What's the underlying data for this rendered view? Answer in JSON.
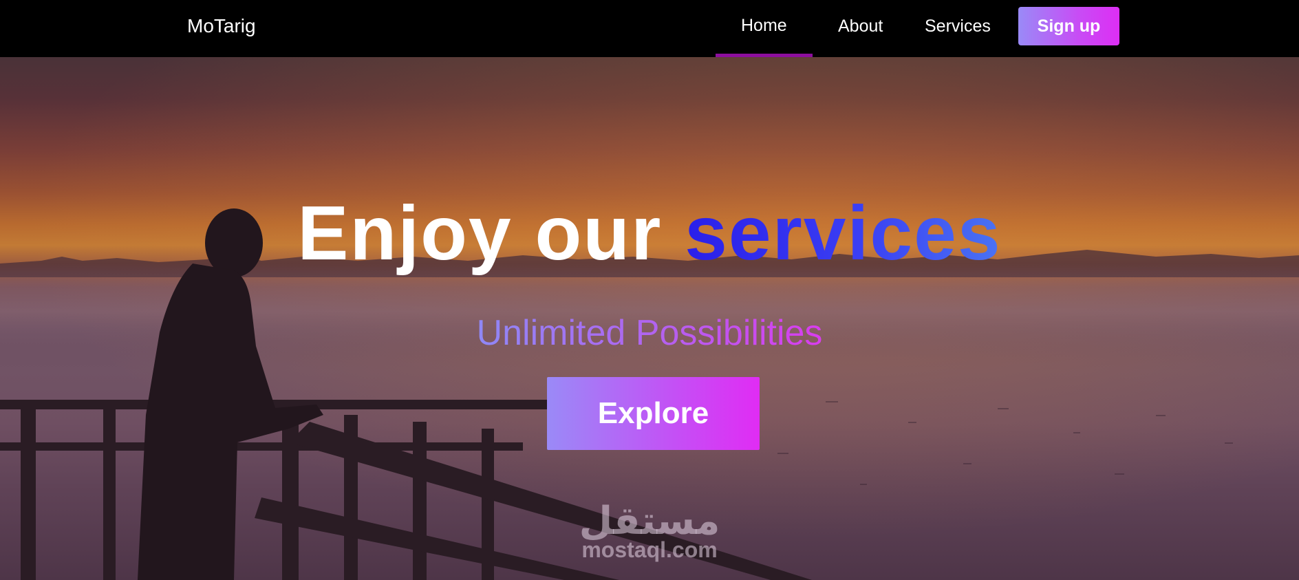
{
  "navbar": {
    "brand": "MoTarig",
    "links": [
      {
        "label": "Home",
        "active": true
      },
      {
        "label": "About",
        "active": false
      },
      {
        "label": "Services",
        "active": false
      }
    ],
    "signup_label": "Sign up"
  },
  "hero": {
    "title_plain": "Enjoy our ",
    "title_accent": "services",
    "subtitle": "Unlimited Possibilities",
    "cta_label": "Explore"
  },
  "watermark": {
    "arabic": "مستقل",
    "latin": "mostaql.com"
  },
  "colors": {
    "accent_blue": "#2a1fe9",
    "gradient_start": "#9a8af7",
    "gradient_end": "#e02cf4",
    "active_underline": "#8d0e9e"
  }
}
